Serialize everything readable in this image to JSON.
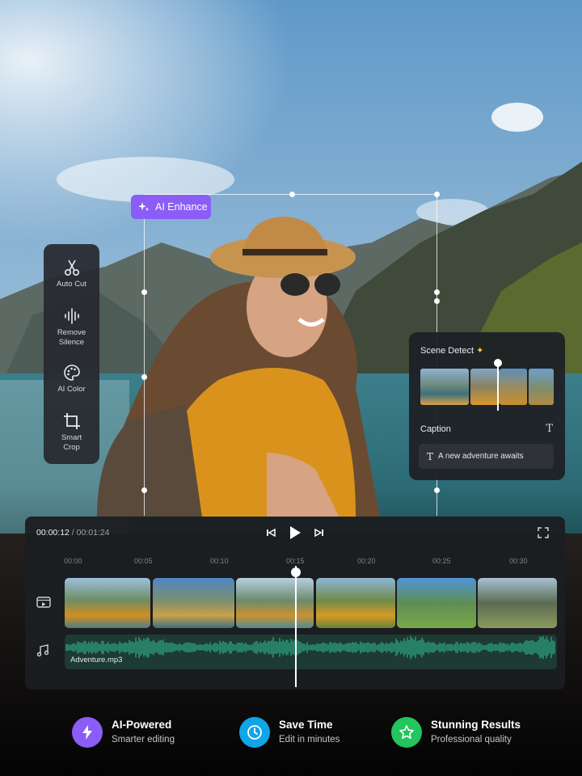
{
  "ai_enhance": {
    "label": "AI Enhance",
    "icon": "sparkles-icon"
  },
  "tools": [
    {
      "label": "Auto Cut",
      "icon": "scissors-icon"
    },
    {
      "label": "Remove Silence",
      "icon": "waveform-icon"
    },
    {
      "label": "AI Color",
      "icon": "palette-icon"
    },
    {
      "label": "Smart Crop",
      "icon": "crop-icon"
    }
  ],
  "scene_panel": {
    "title": "Scene Detect",
    "caption_title": "Caption",
    "caption_text": "A new adventure awaits"
  },
  "editor": {
    "current_time": "00:00:12",
    "total_time": "/ 00:01:24",
    "ruler": [
      "00:00",
      "00:05",
      "00:10",
      "00:15",
      "00:20",
      "00:25",
      "00:30"
    ],
    "audio_file": "Adventure.mp3"
  },
  "features": [
    {
      "title": "AI-Powered",
      "subtitle": "Smarter editing",
      "icon": "lightning-icon",
      "color": "#8b5cf6"
    },
    {
      "title": "Save Time",
      "subtitle": "Edit in minutes",
      "icon": "clock-icon",
      "color": "#0ea5e9"
    },
    {
      "title": "Stunning Results",
      "subtitle": "Professional quality",
      "icon": "star-icon",
      "color": "#22c55e"
    }
  ],
  "colors": {
    "accent": "#8b5cf6",
    "panel": "#1b1d21",
    "audio_wave": "#2fae86"
  }
}
